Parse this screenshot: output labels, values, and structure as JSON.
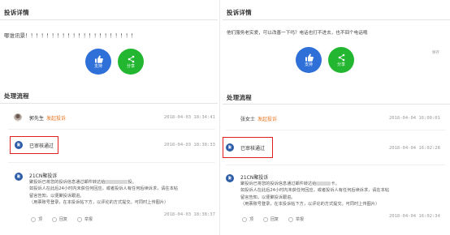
{
  "left": {
    "detail_title": "投诉详情",
    "complaint_text": "哪谁讯景！！！！！！！！！！！！！！！！！！！！！",
    "support_label": "支持",
    "share_label": "分享",
    "process_title": "处理流程",
    "items": [
      {
        "name": "郭先生",
        "action": "发起投诉",
        "time": "2018-04-03 18:34:41"
      },
      {
        "name": "已审核通过",
        "time": "2018-04-03 18:38:33"
      },
      {
        "name": "21CN聚投诉",
        "detail1": "聚投诉已将您的投诉信息通过邮件转达给",
        "detail1b": "投。",
        "detail2": "如投诉人在此后24小时内未获任何回应，或者投诉人有任何后续诉求，请在本帖",
        "detail3": "留言告知，以便聚投诉跟进。",
        "detail4": "（用票账号登录，在本投诉帖下方，以评论的方式提交。可同时上传图片）",
        "time": "2018-04-03 18:38:37",
        "act_like": "顶",
        "act_reply": "回复",
        "act_report": "举报"
      }
    ]
  },
  "right": {
    "detail_title": "投诉详情",
    "complaint_text": "他们服务老实爱，可以改善一下吗？电话也打不进去，也不回个电话哦",
    "support_label": "支持",
    "share_label": "分享",
    "tag": "保存",
    "process_title": "处理流程",
    "items": [
      {
        "name": "张女士",
        "action": "发起投诉",
        "time": "2018-04-04 16:00:01"
      },
      {
        "name": "已审核通过",
        "time": "2018-04-04 16:02:28"
      },
      {
        "name": "21CN聚投诉",
        "detail1": "聚投诉已将您的投诉信息通过邮件转达给",
        "detail1b": "卡。",
        "detail2": "如投诉人在此后24小时内未获任何回应，或者投诉人有任何后续诉求，请在本帖",
        "detail3": "留言告知，以便聚投诉跟进。",
        "detail4": "（用票账号登录，在本投诉帖下方，以评论的方式提交。可同时上传图片）",
        "time": "2018-04-04 16:02:34",
        "act_like": "顶",
        "act_reply": "回复",
        "act_report": "举报"
      }
    ]
  },
  "colors": {
    "blue": "#2e6fd8",
    "green": "#23b630",
    "highlight": "#e02020",
    "action": "#e8731c"
  }
}
